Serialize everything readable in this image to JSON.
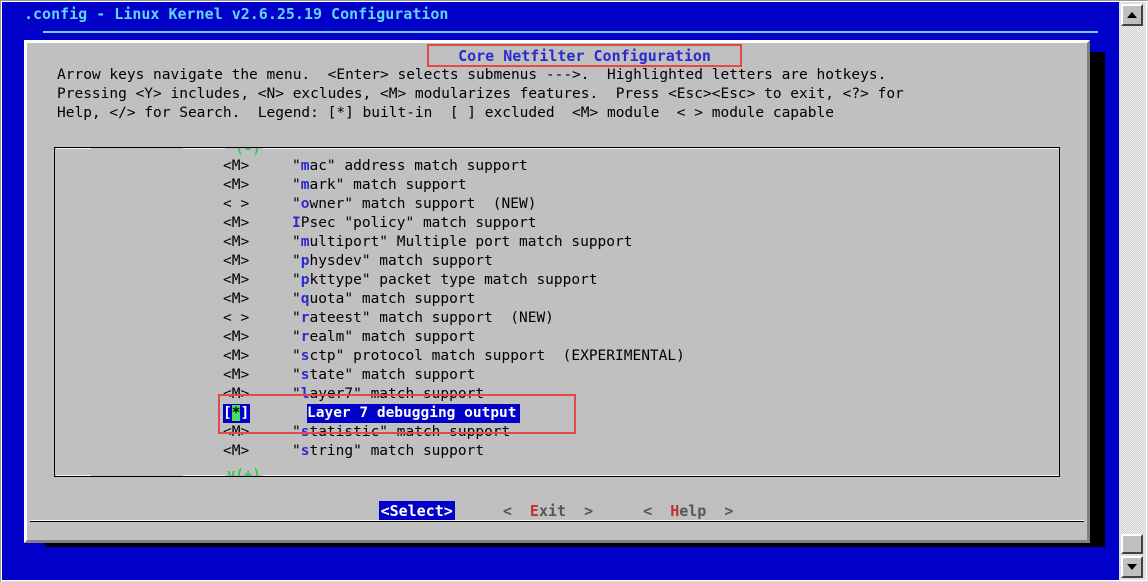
{
  "window": {
    "title": ".config - Linux Kernel v2.6.25.19 Configuration"
  },
  "dialog": {
    "title": "Core Netfilter Configuration",
    "help_lines": [
      "Arrow keys navigate the menu.  <Enter> selects submenus --->.  Highlighted letters are hotkeys.",
      "Pressing <Y> includes, <N> excludes, <M> modularizes features.  Press <Esc><Esc> to exit, <?> for",
      "Help, </> for Search.  Legend: [*] built-in  [ ] excluded  <M> module  < > module capable"
    ]
  },
  "list": {
    "scroll_up_marker": "^(-)",
    "scroll_down_marker": "v(+)",
    "selected_index": 13,
    "items": [
      {
        "flag": "<M>",
        "pre": "\"",
        "hot": "m",
        "post": "ac\" address match support"
      },
      {
        "flag": "<M>",
        "pre": "\"",
        "hot": "m",
        "post": "ark\" match support"
      },
      {
        "flag": "< >",
        "pre": "\"",
        "hot": "o",
        "post": "wner\" match support  (NEW)"
      },
      {
        "flag": "<M>",
        "pre": "",
        "hot": "I",
        "post": "Psec \"policy\" match support"
      },
      {
        "flag": "<M>",
        "pre": "\"",
        "hot": "m",
        "post": "ultiport\" Multiple port match support"
      },
      {
        "flag": "<M>",
        "pre": "\"",
        "hot": "p",
        "post": "hysdev\" match support"
      },
      {
        "flag": "<M>",
        "pre": "\"",
        "hot": "p",
        "post": "kttype\" packet type match support"
      },
      {
        "flag": "<M>",
        "pre": "\"",
        "hot": "q",
        "post": "uota\" match support"
      },
      {
        "flag": "< >",
        "pre": "\"",
        "hot": "r",
        "post": "ateest\" match support  (NEW)"
      },
      {
        "flag": "<M>",
        "pre": "\"",
        "hot": "r",
        "post": "ealm\" match support"
      },
      {
        "flag": "<M>",
        "pre": "\"",
        "hot": "s",
        "post": "ctp\" protocol match support  (EXPERIMENTAL)"
      },
      {
        "flag": "<M>",
        "pre": "\"",
        "hot": "s",
        "post": "tate\" match support"
      },
      {
        "flag": "<M>",
        "pre": "\"",
        "hot": "l",
        "post": "ayer7\" match support"
      },
      {
        "flag": "[*]",
        "pre": "",
        "hot": "",
        "post": "Layer 7 debugging output",
        "selected": true,
        "star": "*"
      },
      {
        "flag": "<M>",
        "pre": "\"",
        "hot": "s",
        "post": "tatistic\" match support"
      },
      {
        "flag": "<M>",
        "pre": "\"",
        "hot": "s",
        "post": "tring\" match support"
      }
    ]
  },
  "buttons": [
    {
      "left": "<",
      "hot": "S",
      "rest": "elect",
      "right": ">",
      "primary": true
    },
    {
      "left": "<  ",
      "hot": "E",
      "rest": "xit",
      "right": "  >",
      "primary": false
    },
    {
      "left": "<  ",
      "hot": "H",
      "rest": "elp",
      "right": "  >",
      "primary": false
    }
  ],
  "colors": {
    "terminal_bg": "#0000c8",
    "dialog_bg": "#c0c0c0",
    "title_fg": "#63d3f6",
    "hotkey": "#2a2ad0",
    "marker_green": "#2ecc55",
    "annotation_red": "#e04a4a",
    "star_green": "#44e05a"
  }
}
